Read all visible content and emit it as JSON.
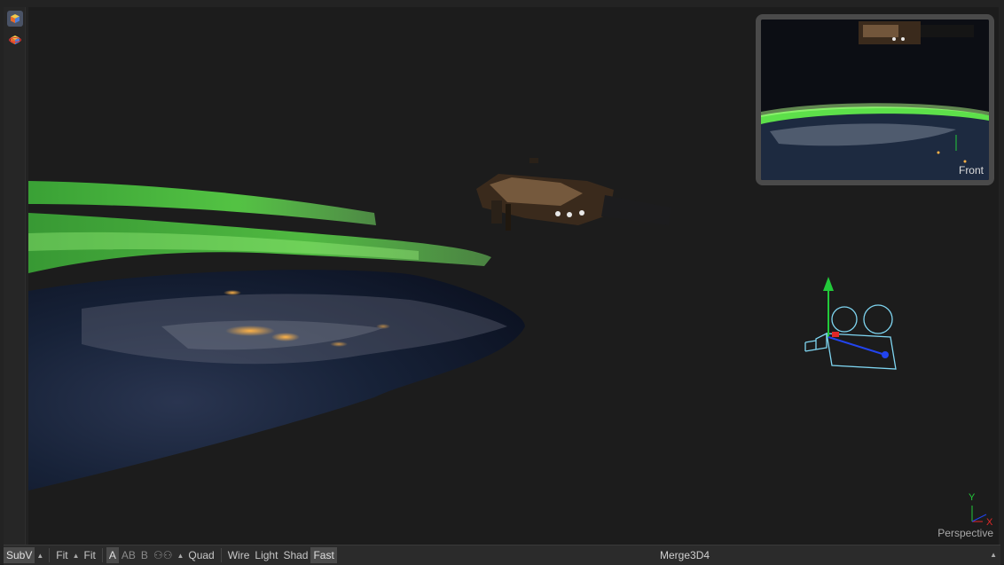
{
  "viewport": {
    "view_label": "Perspective",
    "inset_label": "Front",
    "axis_y": "Y",
    "axis_x": "X"
  },
  "toolbar": {
    "subv": "SubV",
    "fit1": "Fit",
    "fit2": "Fit",
    "a": "A",
    "ab": "AB",
    "b": "B",
    "stereo_icon": "glasses-icon",
    "quad": "Quad",
    "wire": "Wire",
    "light": "Light",
    "shad": "Shad",
    "fast": "Fast",
    "node_name": "Merge3D4"
  },
  "colors": {
    "aurora": "#5de04a",
    "camera": "#7fd6f2",
    "y_axis": "#22c93a",
    "x_axis": "#e02828",
    "z_axis": "#2244ee"
  }
}
